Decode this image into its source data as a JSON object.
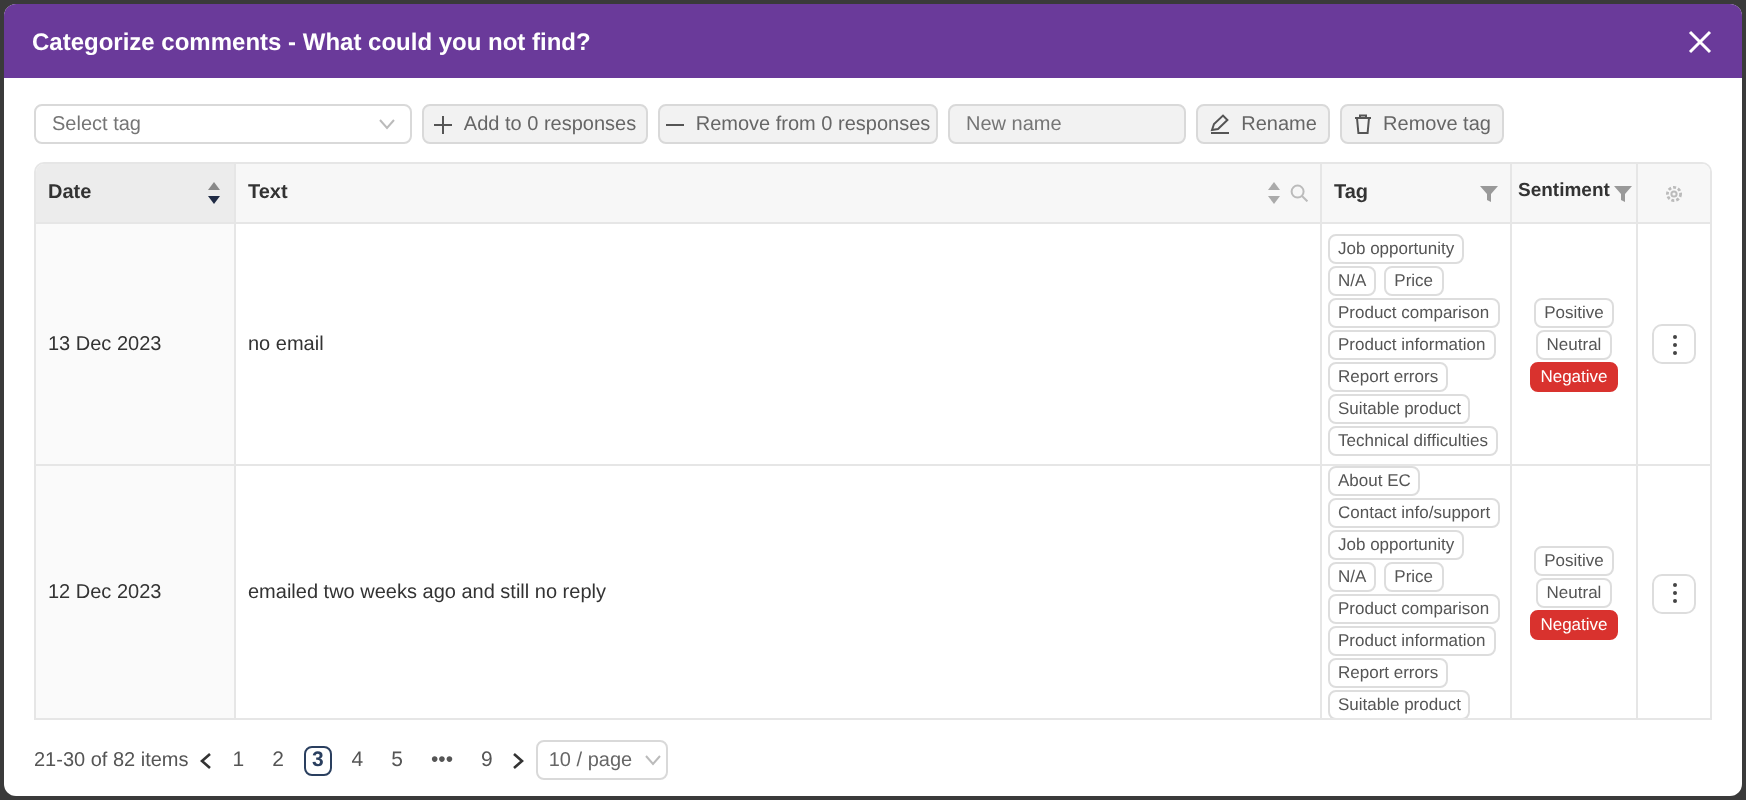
{
  "window": {
    "title": "Categorize comments - What could you not find?"
  },
  "toolbar": {
    "tag_select": {
      "placeholder": "Select tag"
    },
    "add_button": "Add to 0 responses",
    "remove_button": "Remove from 0 responses",
    "name_field": {
      "placeholder": "New name"
    },
    "rename_button": "Rename",
    "remove_tag_button": "Remove tag"
  },
  "table": {
    "columns": [
      "Date",
      "Text",
      "Tag",
      "Sentiment"
    ],
    "rows": [
      {
        "date": "13 Dec 2023",
        "text": "no email",
        "tags": [
          "Job opportunity",
          "N/A",
          "Price",
          "Product comparison",
          "Product information",
          "Report errors",
          "Suitable product",
          "Technical difficulties"
        ],
        "sentiments": [
          {
            "label": "Positive",
            "selected": false
          },
          {
            "label": "Neutral",
            "selected": false
          },
          {
            "label": "Negative",
            "selected": true
          }
        ]
      },
      {
        "date": "12 Dec 2023",
        "text": "emailed two weeks ago and still no reply",
        "tags": [
          "About EC",
          "Contact info/support",
          "Job opportunity",
          "N/A",
          "Price",
          "Product comparison",
          "Product information",
          "Report errors",
          "Suitable product"
        ],
        "sentiments": [
          {
            "label": "Positive",
            "selected": false
          },
          {
            "label": "Neutral",
            "selected": false
          },
          {
            "label": "Negative",
            "selected": true
          }
        ]
      }
    ]
  },
  "pagination": {
    "range": "21-30 of 82 items",
    "pages": [
      {
        "label": "1",
        "selected": false
      },
      {
        "label": "2",
        "selected": false
      },
      {
        "label": "3",
        "selected": true
      },
      {
        "label": "4",
        "selected": false
      },
      {
        "label": "5",
        "selected": false
      },
      {
        "label": "•••",
        "selected": false
      },
      {
        "label": "9",
        "selected": false
      }
    ],
    "page_size": "10 / page"
  }
}
